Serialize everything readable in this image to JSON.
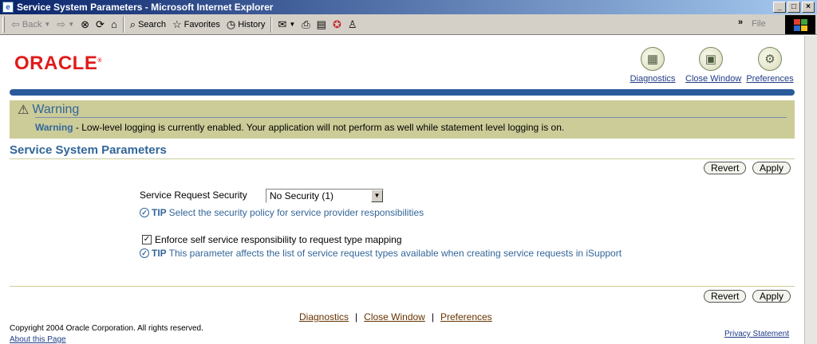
{
  "window": {
    "title": "Service System Parameters - Microsoft Internet Explorer",
    "controls": [
      "_",
      "□",
      "×"
    ]
  },
  "toolbar": {
    "back": "Back",
    "search": "Search",
    "favorites": "Favorites",
    "history": "History",
    "file_menu": "File"
  },
  "global_links": [
    {
      "label": "Diagnostics",
      "icon": "diagnostics-icon"
    },
    {
      "label": "Close Window",
      "icon": "close-window-icon"
    },
    {
      "label": "Preferences",
      "icon": "preferences-icon"
    }
  ],
  "logo": {
    "text": "ORACLE",
    "mark": "®"
  },
  "warning": {
    "title": "Warning",
    "label": "Warning",
    "message": " - Low-level logging is currently enabled. Your application will not perform as well while statement level logging is on."
  },
  "page": {
    "heading": "Service System Parameters",
    "revert_label": "Revert",
    "apply_label": "Apply"
  },
  "form": {
    "security_label": "Service Request Security",
    "security_value": "No Security (1)",
    "security_tip": "Select the security policy for service provider responsibilities",
    "enforce_label": "Enforce self service responsibility to request type mapping",
    "enforce_checked": true,
    "enforce_tip": "This parameter affects the list of service request types available when creating service requests in iSupport",
    "tip_label": "TIP"
  },
  "footer": {
    "links": [
      "Diagnostics",
      "Close Window",
      "Preferences"
    ],
    "separator": "|",
    "copyright": "Copyright 2004 Oracle Corporation. All rights reserved.",
    "about": "About this Page",
    "privacy": "Privacy Statement"
  },
  "colors": {
    "accent": "#336699",
    "warning_bg": "#cccc99",
    "logo_red": "#e01b1b",
    "link_brown": "#663300"
  }
}
